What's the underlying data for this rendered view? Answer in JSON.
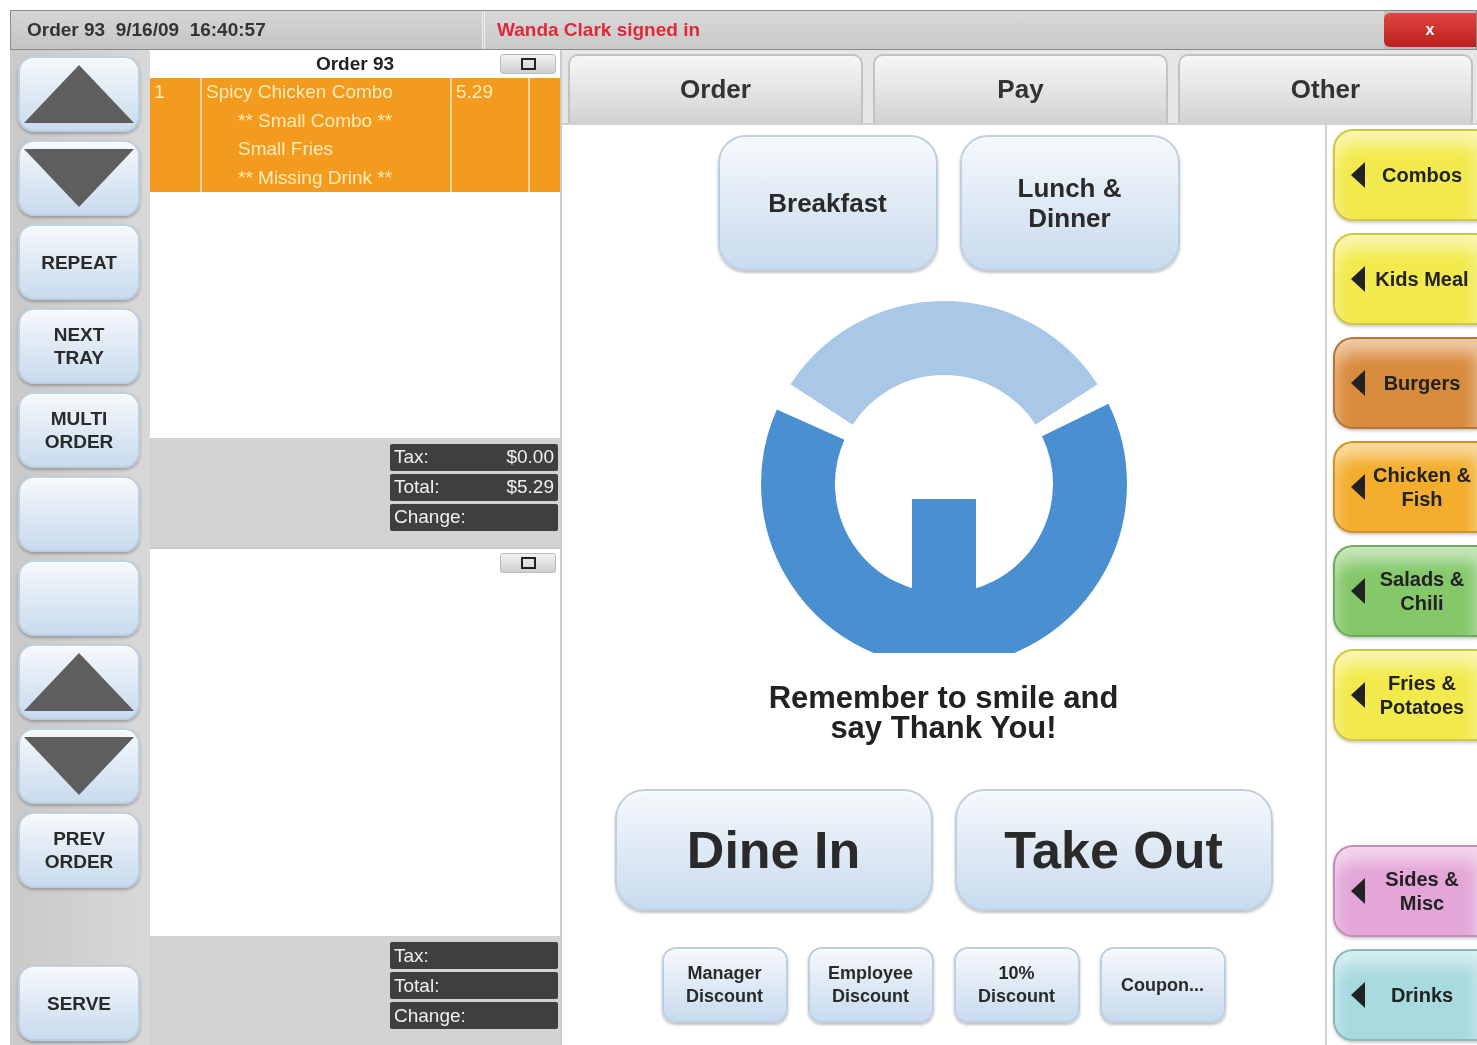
{
  "header": {
    "order_info": "Order 93  9/16/09  16:40:57",
    "signed_in": "Wanda Clark signed in",
    "close": "x"
  },
  "left_buttons": [
    {
      "kind": "up"
    },
    {
      "kind": "down"
    },
    {
      "kind": "text",
      "label": "REPEAT"
    },
    {
      "kind": "text",
      "label": "NEXT TRAY"
    },
    {
      "kind": "text",
      "label": "MULTI ORDER"
    },
    {
      "kind": "blank"
    },
    {
      "kind": "blank"
    },
    {
      "kind": "up"
    },
    {
      "kind": "down"
    },
    {
      "kind": "text",
      "label": "PREV ORDER"
    },
    {
      "kind": "text",
      "label": "SERVE"
    }
  ],
  "orders": [
    {
      "title": "Order 93",
      "lines": [
        {
          "qty": "1",
          "item": "Spicy Chicken Combo",
          "price": "5.29",
          "modifiers": [
            "** Small Combo **",
            "Small Fries",
            "** Missing Drink **"
          ]
        }
      ],
      "totals": [
        {
          "label": "Tax:",
          "value": "$0.00"
        },
        {
          "label": "Total:",
          "value": "$5.29"
        },
        {
          "label": "Change:"
        }
      ]
    },
    {
      "totals": [
        {
          "label": "Tax:"
        },
        {
          "label": "Total:"
        },
        {
          "label": "Change:"
        }
      ]
    }
  ],
  "tabs": [
    "Order",
    "Pay",
    "Other"
  ],
  "meals": [
    "Breakfast",
    "Lunch & Dinner"
  ],
  "message": "Remember to smile and say Thank You!",
  "service": [
    "Dine In",
    "Take Out"
  ],
  "discounts": [
    "Manager Discount",
    "Employee Discount",
    "10% Discount",
    "Coupon..."
  ],
  "categories": [
    {
      "label": "Combos",
      "color": "#f2ea4c"
    },
    {
      "label": "Kids Meal",
      "color": "#f2ea4c"
    },
    {
      "label": "Burgers",
      "color": "#d98b3c"
    },
    {
      "label": "Chicken & Fish",
      "color": "#f4ad2c"
    },
    {
      "label": "Salads & Chili",
      "color": "#84c86a"
    },
    {
      "label": "Fries & Potatoes",
      "color": "#f2ea4c"
    },
    {
      "label": "Sides & Misc",
      "color": "#e4a6d8"
    },
    {
      "label": "Drinks",
      "color": "#a6dadf"
    }
  ]
}
